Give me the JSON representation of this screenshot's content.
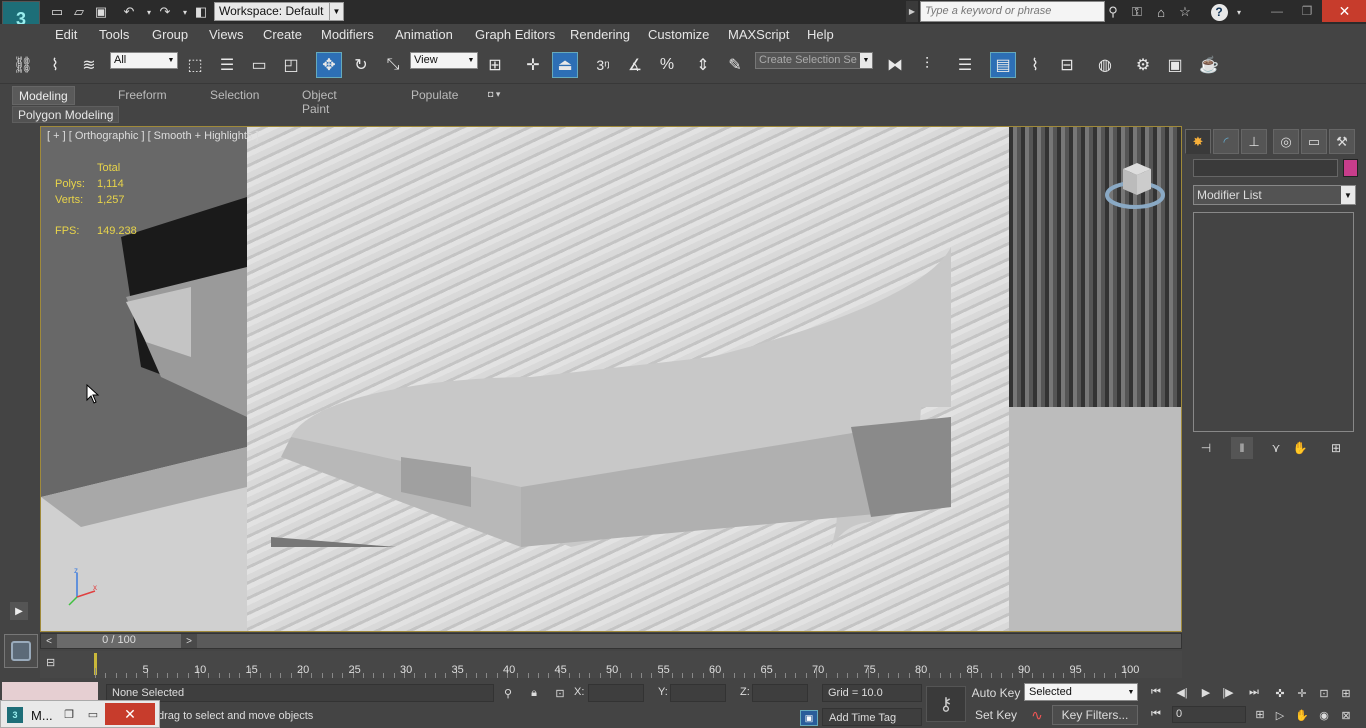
{
  "titlebar": {
    "workspace_label": "Workspace: Default",
    "search_placeholder": "Type a keyword or phrase"
  },
  "menubar": {
    "items": [
      "Edit",
      "Tools",
      "Group",
      "Views",
      "Create",
      "Modifiers",
      "Animation",
      "Graph Editors",
      "Rendering",
      "Customize",
      "MAXScript",
      "Help"
    ]
  },
  "toolbar": {
    "selection_filter": "All",
    "ref_coord": "View",
    "snap_angle_label": "3",
    "named_selection_placeholder": "Create Selection Se"
  },
  "ribbon": {
    "tabs": [
      "Modeling",
      "Freeform",
      "Selection",
      "Object Paint",
      "Populate"
    ],
    "active_tab": "Modeling",
    "panel_label": "Polygon Modeling"
  },
  "viewport": {
    "label": "[ + ] [ Orthographic ] [ Smooth + Highlights ]",
    "stats_header": "Total",
    "polys_label": "Polys:",
    "polys_value": "1,114",
    "verts_label": "Verts:",
    "verts_value": "1,257",
    "fps_label": "FPS:",
    "fps_value": "149.238"
  },
  "command_panel": {
    "modifier_list_label": "Modifier List",
    "object_color": "#c83d8b"
  },
  "timeline": {
    "frame_label": "0 / 100",
    "ticks": [
      "5",
      "10",
      "15",
      "20",
      "25",
      "30",
      "35",
      "40",
      "45",
      "50",
      "55",
      "60",
      "65",
      "70",
      "75",
      "80",
      "85",
      "90",
      "95",
      "100"
    ]
  },
  "statusbar": {
    "selection_status": "None Selected",
    "prompt_text": "drag to select and move objects",
    "x_label": "X:",
    "y_label": "Y:",
    "z_label": "Z:",
    "grid_readout": "Grid = 10.0",
    "add_time_tag": "Add Time Tag",
    "auto_key": "Auto Key",
    "set_key": "Set Key",
    "key_mode": "Selected",
    "key_filters": "Key Filters...",
    "current_frame": "0"
  },
  "taskbar": {
    "app_label": "M..."
  }
}
